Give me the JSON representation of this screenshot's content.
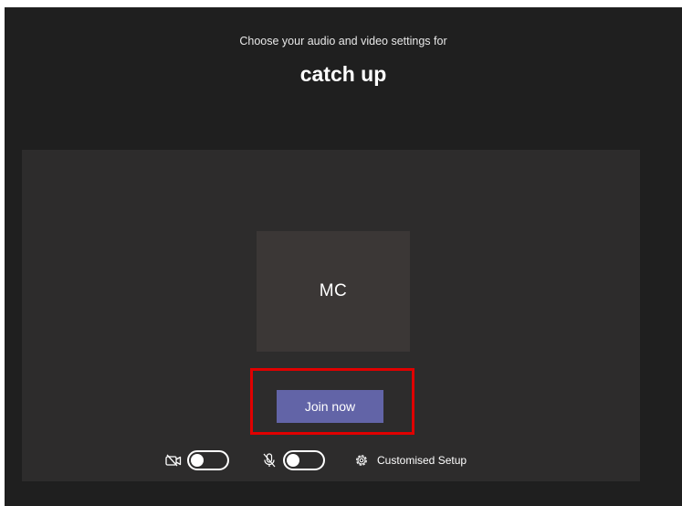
{
  "prejoin": {
    "subtitle": "Choose your audio and video settings for",
    "meeting_title": "catch up",
    "avatar_initials": "MC",
    "join_button_label": "Join now",
    "camera": {
      "icon": "camera-off-icon",
      "enabled": false
    },
    "microphone": {
      "icon": "mic-off-icon",
      "enabled": false
    },
    "settings": {
      "icon": "gear-icon",
      "label": "Customised Setup"
    }
  },
  "colors": {
    "background": "#1f1f1f",
    "panel": "#2d2c2c",
    "avatar_tile": "#3b3736",
    "join_button": "#6264a7",
    "highlight": "#e00000"
  }
}
